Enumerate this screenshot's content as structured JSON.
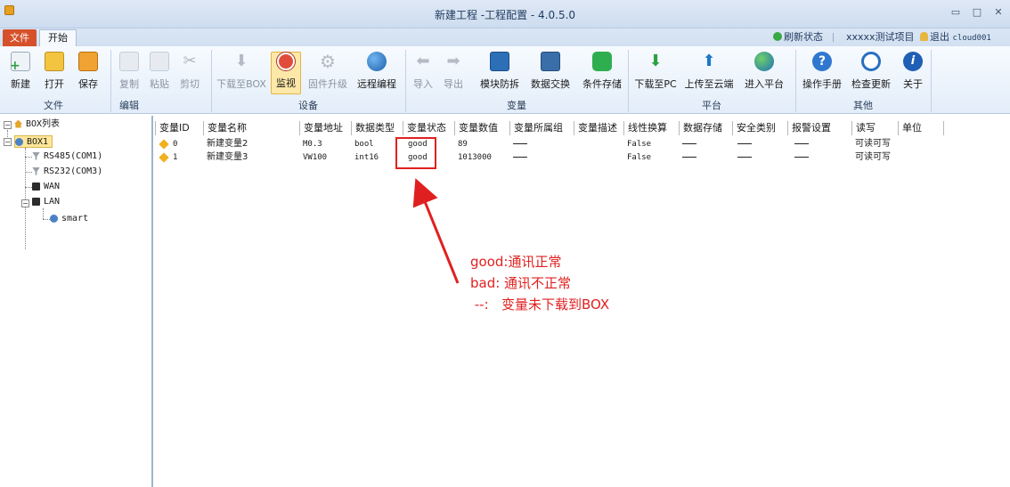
{
  "window": {
    "title": "新建工程 -工程配置 - 4.0.5.0",
    "minimize": "▭",
    "maximize": "□",
    "close": "✕"
  },
  "tabs": {
    "file": "文件",
    "start": "开始"
  },
  "topright": {
    "refresh": "刷新状态",
    "project": "xxxxx测试项目",
    "logout": "退出",
    "user": "cloud001"
  },
  "ribbon": {
    "file_group": {
      "label": "文件",
      "new": "新建",
      "open": "打开",
      "save": "保存"
    },
    "edit_group": {
      "label": "编辑",
      "copy": "复制",
      "paste": "粘贴",
      "cut": "剪切"
    },
    "device_group": {
      "label": "设备",
      "download_box": "下载至BOX",
      "monitor": "监视",
      "firmware": "固件升级",
      "remote": "远程编程"
    },
    "var_group": {
      "label": "变量",
      "import": "导入",
      "export": "导出",
      "module_split": "模块防拆",
      "data_exchange": "数据交换",
      "cond_store": "条件存储"
    },
    "platform_group": {
      "label": "平台",
      "download_pc": "下载至PC",
      "upload_cloud": "上传至云端",
      "enter_platform": "进入平台"
    },
    "other_group": {
      "label": "其他",
      "manual": "操作手册",
      "check_update": "检查更新",
      "about": "关于"
    }
  },
  "tree": {
    "root": "BOX列表",
    "box": "BOX1",
    "rs485": "RS485(COM1)",
    "rs232": "RS232(COM3)",
    "wan": "WAN",
    "lan": "LAN",
    "smart": "smart"
  },
  "grid": {
    "headers": [
      "变量ID",
      "变量名称",
      "变量地址",
      "数据类型",
      "变量状态",
      "变量数值",
      "变量所属组",
      "变量描述",
      "线性换算",
      "数据存储",
      "安全类别",
      "报警设置",
      "读写",
      "单位"
    ],
    "rows": [
      {
        "id": "0",
        "name": "新建变量2",
        "addr": "M0.3",
        "type": "bool",
        "status": "good",
        "value": "89",
        "linear": "False",
        "rw": "可读可写"
      },
      {
        "id": "1",
        "name": "新建变量3",
        "addr": "VW100",
        "type": "int16",
        "status": "good",
        "value": "1013000",
        "linear": "False",
        "rw": "可读可写"
      }
    ]
  },
  "annotation": {
    "line1": "good:通讯正常",
    "line2": "bad:  通讯不正常",
    "line3": " --:   变量未下载到BOX"
  },
  "colors": {
    "accent": "#d6512b",
    "annotation": "#e02020",
    "ribbon_bg": "#e3edf9"
  }
}
